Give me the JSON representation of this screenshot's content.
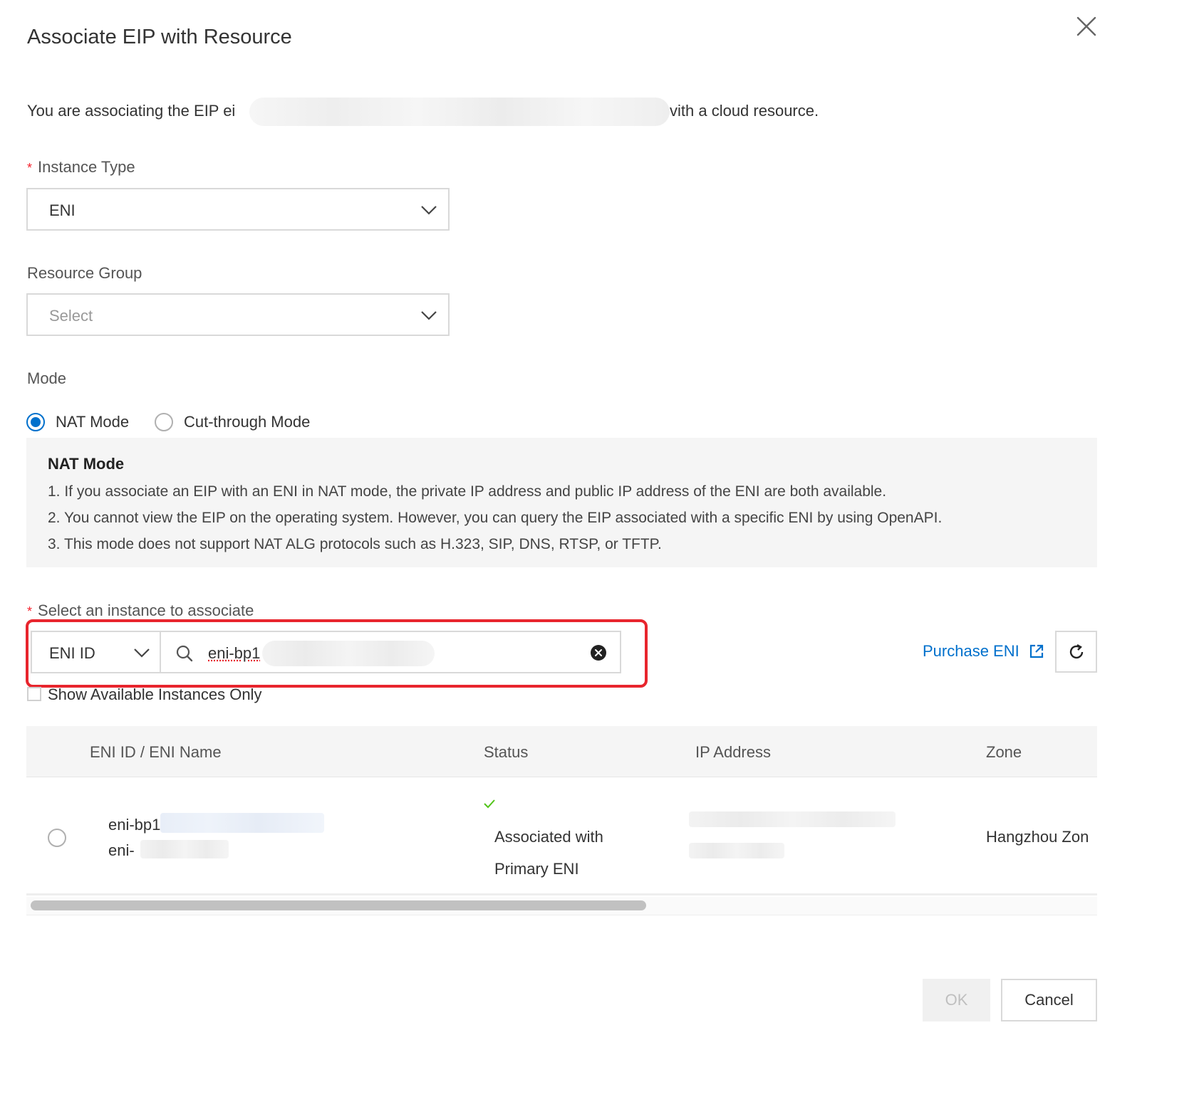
{
  "dialog": {
    "title": "Associate EIP with Resource",
    "intro_prefix": "You are associating the EIP ei",
    "intro_suffix": "vith a cloud resource."
  },
  "instance_type": {
    "label": "Instance Type",
    "value": "ENI"
  },
  "resource_group": {
    "label": "Resource Group",
    "placeholder": "Select"
  },
  "mode": {
    "label": "Mode",
    "options": [
      {
        "label": "NAT Mode",
        "selected": true
      },
      {
        "label": "Cut-through Mode",
        "selected": false
      }
    ],
    "notice": {
      "heading": "NAT Mode",
      "lines": [
        "1. If you associate an EIP with an ENI in NAT mode, the private IP address and public IP address of the ENI are both available.",
        "2. You cannot view the EIP on the operating system. However, you can query the EIP associated with a specific ENI by using OpenAPI.",
        "3. This mode does not support NAT ALG protocols such as H.323, SIP, DNS, RTSP, or TFTP."
      ]
    }
  },
  "instance_select": {
    "label": "Select an instance to associate",
    "search_type": "ENI ID",
    "search_value": "eni-bp1",
    "purchase_link": "Purchase ENI",
    "available_only_label": "Show Available Instances Only"
  },
  "table": {
    "columns": [
      "ENI ID / ENI Name",
      "Status",
      "IP Address",
      "Zone"
    ],
    "rows": [
      {
        "eni_id": "eni-bp1",
        "eni_name": "eni-",
        "status_line1": "Associated with",
        "status_line2": "Primary ENI",
        "zone": "Hangzhou Zon"
      }
    ]
  },
  "footer": {
    "ok_label": "OK",
    "cancel_label": "Cancel"
  },
  "colors": {
    "accent": "#0070cc",
    "required": "#f5222d",
    "highlight_border": "#e8252d",
    "success": "#52c41a"
  }
}
